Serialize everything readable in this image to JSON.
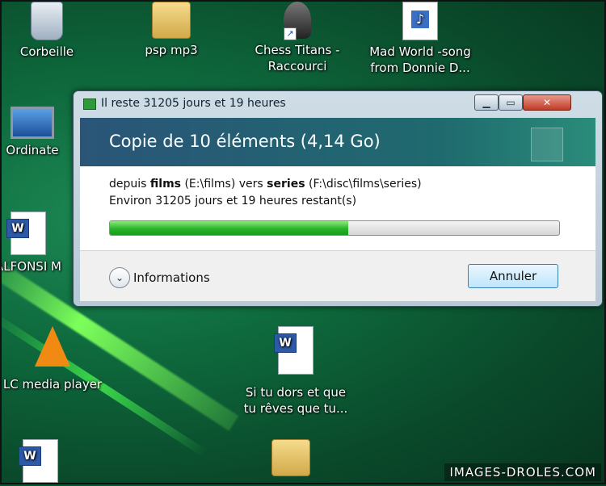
{
  "desktop": {
    "icons": [
      {
        "label": "Corbeille"
      },
      {
        "label": "psp mp3"
      },
      {
        "label": "Chess Titans - Raccourci"
      },
      {
        "label": "Mad World -song from  Donnie D..."
      },
      {
        "label": "Ordinate"
      },
      {
        "label": "ALFONSI M"
      },
      {
        "label": "LC media player"
      },
      {
        "label": "Si tu dors et que tu rêves que tu..."
      }
    ],
    "watermark": "IMAGES-DROLES.COM"
  },
  "dialog": {
    "title": "Il reste 31205 jours et 19 heures",
    "header": "Copie de 10 éléments (4,14 Go)",
    "from_prefix": "depuis",
    "source_name": "films",
    "source_path": "(E:\\films)",
    "to_word": "vers",
    "dest_name": "series",
    "dest_path": "(F:\\disc\\films\\series)",
    "remaining": "Environ 31205 jours et 19 heures restant(s)",
    "progress_fraction": 0.53,
    "progress_color": "#27b52a",
    "info_label": "Informations",
    "cancel_label": "Annuler",
    "minimize_icon": "minimize-icon",
    "maximize_icon": "maximize-icon",
    "close_icon": "close-icon",
    "close_symbol": "✕"
  }
}
